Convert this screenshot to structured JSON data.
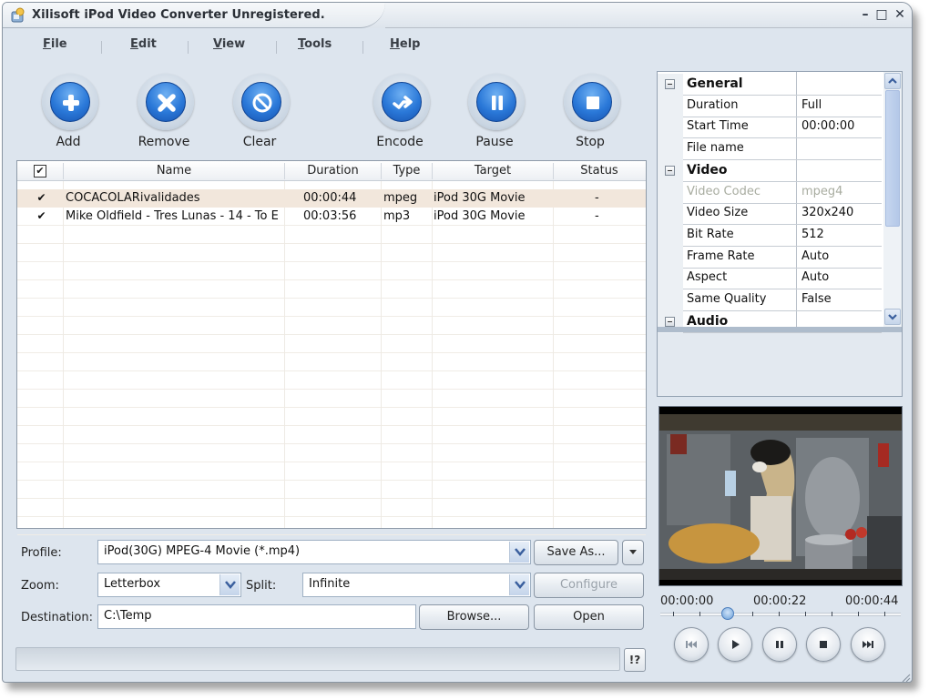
{
  "window": {
    "title": "Xilisoft iPod Video Converter Unregistered.",
    "controls": {
      "minimize": "–",
      "maximize": "□",
      "close": "✕"
    }
  },
  "menu": [
    {
      "label": "File",
      "accel": "F"
    },
    {
      "label": "Edit",
      "accel": "E"
    },
    {
      "label": "View",
      "accel": "V"
    },
    {
      "label": "Tools",
      "accel": "T"
    },
    {
      "label": "Help",
      "accel": "H"
    }
  ],
  "toolbar": [
    {
      "label": "Add",
      "icon": "plus-icon"
    },
    {
      "label": "Remove",
      "icon": "x-icon"
    },
    {
      "label": "Clear",
      "icon": "no-entry-icon"
    },
    {
      "label": "Encode",
      "icon": "arrow-right-icon"
    },
    {
      "label": "Pause",
      "icon": "pause-icon"
    },
    {
      "label": "Stop",
      "icon": "stop-icon"
    }
  ],
  "file_list": {
    "header_checked": true,
    "columns": [
      "Name",
      "Duration",
      "Type",
      "Target",
      "Status"
    ],
    "rows": [
      {
        "checked": true,
        "name": "COCACOLARivalidades",
        "duration": "00:00:44",
        "type": "mpeg",
        "target": "iPod 30G Movie",
        "status": "-",
        "selected": true
      },
      {
        "checked": true,
        "name": "Mike Oldfield - Tres Lunas - 14 - To E",
        "duration": "00:03:56",
        "type": "mp3",
        "target": "iPod 30G Movie",
        "status": "-",
        "selected": false
      }
    ]
  },
  "settings": {
    "profile_label": "Profile:",
    "profile_value": "iPod(30G) MPEG-4 Movie  (*.mp4)",
    "save_as_label": "Save As...",
    "zoom_label": "Zoom:",
    "zoom_value": "Letterbox",
    "split_label": "Split:",
    "split_value": "Infinite",
    "configure_label": "Configure",
    "destination_label": "Destination:",
    "destination_value": "C:\\Temp",
    "browse_label": "Browse...",
    "open_label": "Open"
  },
  "properties": [
    {
      "kind": "category",
      "name": "General",
      "value": ""
    },
    {
      "kind": "item",
      "name": "Duration",
      "value": "Full"
    },
    {
      "kind": "item",
      "name": "Start Time",
      "value": "00:00:00"
    },
    {
      "kind": "item",
      "name": "File name",
      "value": ""
    },
    {
      "kind": "category",
      "name": "Video",
      "value": ""
    },
    {
      "kind": "disabled",
      "name": "Video Codec",
      "value": "mpeg4"
    },
    {
      "kind": "item",
      "name": "Video Size",
      "value": "320x240"
    },
    {
      "kind": "item",
      "name": "Bit Rate",
      "value": "512"
    },
    {
      "kind": "item",
      "name": "Frame Rate",
      "value": "Auto"
    },
    {
      "kind": "item",
      "name": "Aspect",
      "value": "Auto"
    },
    {
      "kind": "item",
      "name": "Same Quality",
      "value": "False"
    },
    {
      "kind": "category",
      "name": "Audio",
      "value": ""
    }
  ],
  "player": {
    "time_start": "00:00:00",
    "time_mid": "00:00:22",
    "time_end": "00:00:44",
    "position_fraction": 0.17,
    "buttons": [
      "previous-icon",
      "play-icon",
      "pause-icon",
      "stop-icon",
      "next-icon"
    ]
  },
  "statusbar": {
    "help_label": "!?"
  },
  "colors": {
    "accent_blue": "#2a78d8",
    "selected_row": "#f2e7dc",
    "window_bg": "#dde5ee"
  }
}
